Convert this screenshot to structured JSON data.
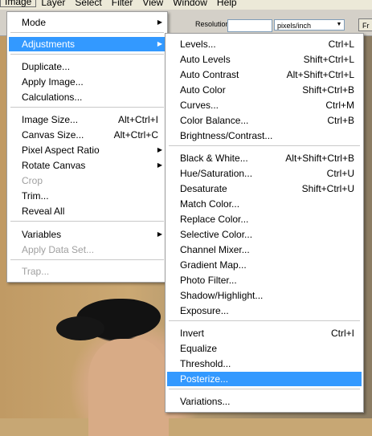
{
  "menubar": {
    "items": [
      "Image",
      "Layer",
      "Select",
      "Filter",
      "View",
      "Window",
      "Help"
    ]
  },
  "options": {
    "resolution_label": "Resolution:",
    "resolution_value": "",
    "units_selected": "pixels/inch",
    "button_label": "Fr"
  },
  "image_menu": {
    "items": [
      {
        "label": "Mode",
        "submenu": true
      },
      {
        "label": "Adjustments",
        "submenu": true,
        "selected": true
      },
      {
        "label": "Duplicate..."
      },
      {
        "label": "Apply Image..."
      },
      {
        "label": "Calculations..."
      },
      {
        "label": "Image Size...",
        "shortcut": "Alt+Ctrl+I"
      },
      {
        "label": "Canvas Size...",
        "shortcut": "Alt+Ctrl+C"
      },
      {
        "label": "Pixel Aspect Ratio",
        "submenu": true
      },
      {
        "label": "Rotate Canvas",
        "submenu": true
      },
      {
        "label": "Crop",
        "disabled": true
      },
      {
        "label": "Trim..."
      },
      {
        "label": "Reveal All"
      },
      {
        "label": "Variables",
        "submenu": true
      },
      {
        "label": "Apply Data Set...",
        "disabled": true
      },
      {
        "label": "Trap...",
        "disabled": true
      }
    ]
  },
  "adjustments_menu": {
    "items": [
      {
        "label": "Levels...",
        "shortcut": "Ctrl+L"
      },
      {
        "label": "Auto Levels",
        "shortcut": "Shift+Ctrl+L"
      },
      {
        "label": "Auto Contrast",
        "shortcut": "Alt+Shift+Ctrl+L"
      },
      {
        "label": "Auto Color",
        "shortcut": "Shift+Ctrl+B"
      },
      {
        "label": "Curves...",
        "shortcut": "Ctrl+M"
      },
      {
        "label": "Color Balance...",
        "shortcut": "Ctrl+B"
      },
      {
        "label": "Brightness/Contrast..."
      },
      {
        "label": "Black & White...",
        "shortcut": "Alt+Shift+Ctrl+B"
      },
      {
        "label": "Hue/Saturation...",
        "shortcut": "Ctrl+U"
      },
      {
        "label": "Desaturate",
        "shortcut": "Shift+Ctrl+U"
      },
      {
        "label": "Match Color..."
      },
      {
        "label": "Replace Color..."
      },
      {
        "label": "Selective Color..."
      },
      {
        "label": "Channel Mixer..."
      },
      {
        "label": "Gradient Map..."
      },
      {
        "label": "Photo Filter..."
      },
      {
        "label": "Shadow/Highlight..."
      },
      {
        "label": "Exposure..."
      },
      {
        "label": "Invert",
        "shortcut": "Ctrl+I"
      },
      {
        "label": "Equalize"
      },
      {
        "label": "Threshold..."
      },
      {
        "label": "Posterize...",
        "selected": true
      },
      {
        "label": "Variations..."
      }
    ]
  },
  "colors": {
    "highlight": "#3399ff",
    "disabled_text": "#a0a0a0"
  }
}
